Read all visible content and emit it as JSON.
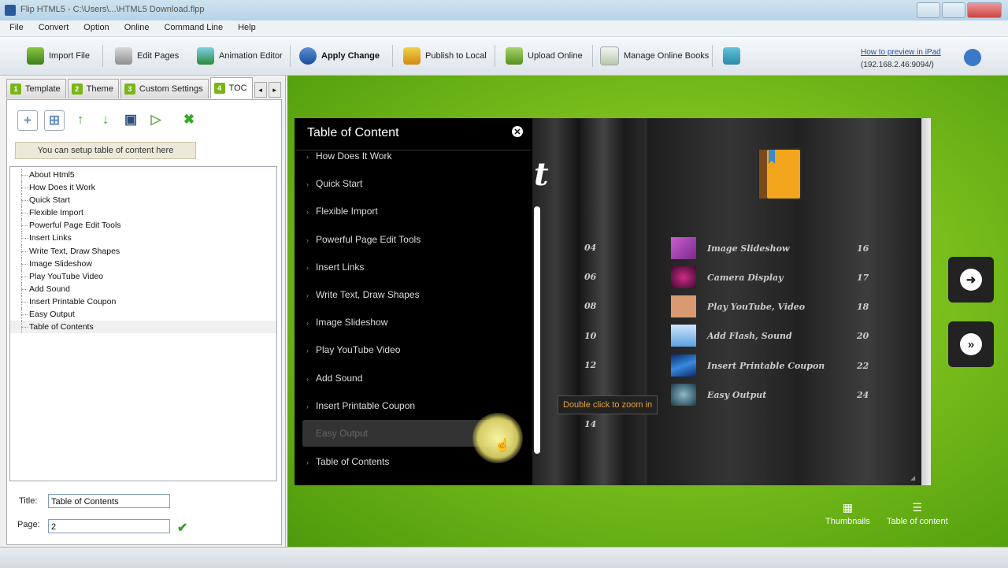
{
  "window": {
    "title": "Flip HTML5 - C:\\Users\\...\\HTML5 Download.flpp"
  },
  "menu": [
    "File",
    "Convert",
    "Option",
    "Online",
    "Command Line",
    "Help"
  ],
  "toolbar": {
    "import_file": "Import File",
    "edit_pages": "Edit Pages",
    "animation_editor": "Animation Editor",
    "apply_change": "Apply Change",
    "publish_local": "Publish to Local",
    "upload_online": "Upload Online",
    "manage_online_books": "Manage Online Books",
    "preview_link": "How to preview in iPad",
    "preview_ip": "(192.168.2.46:9094/)"
  },
  "tabs": [
    {
      "num": "1",
      "label": "Template"
    },
    {
      "num": "2",
      "label": "Theme"
    },
    {
      "num": "3",
      "label": "Custom Settings"
    },
    {
      "num": "4",
      "label": "TOC"
    }
  ],
  "toc_panel": {
    "hint": "You can setup table of content here",
    "tree": [
      "About Html5",
      "How Does it Work",
      "Quick Start",
      "Flexible Import",
      "Powerful Page Edit Tools",
      "Insert Links",
      "Write Text, Draw Shapes",
      "Image Slideshow",
      "Play YouTube Video",
      "Add Sound",
      "Insert Printable Coupon",
      "Easy Output",
      "Table of Contents"
    ],
    "title_label": "Title:",
    "title_value": "Table of Contents",
    "page_label": "Page:",
    "page_value": "2"
  },
  "viewer": {
    "toc_header": "Table of Content",
    "toc_items": [
      "How Does It Work",
      "Quick Start",
      "Flexible Import",
      "Powerful Page Edit Tools",
      "Insert Links",
      "Write Text, Draw Shapes",
      "Image Slideshow",
      "Play YouTube Video",
      "Add Sound",
      "Insert Printable Coupon",
      "Easy Output",
      "Table of Contents"
    ],
    "selected_item": "Easy Output",
    "book_title_fragment": "t",
    "left_page_numbers": [
      "04",
      "06",
      "08",
      "10",
      "12",
      "14"
    ],
    "right_entries": [
      {
        "label": "Image Slideshow",
        "page": "16",
        "color": "#b04bb8"
      },
      {
        "label": "Camera Display",
        "page": "17",
        "color": "#5a1043"
      },
      {
        "label": "Play YouTube, Video",
        "page": "18",
        "color": "#d99a72"
      },
      {
        "label": "Add Flash, Sound",
        "page": "20",
        "color": "#8fc6ef"
      },
      {
        "label": "Insert Printable Coupon",
        "page": "22",
        "color": "#1c5ab5"
      },
      {
        "label": "Easy Output",
        "page": "24",
        "color": "#3e6f88"
      }
    ],
    "zoom_tip": "Double click to zoom in",
    "thumbnails_label": "Thumbnails",
    "toc_button_label": "Table of content"
  },
  "colors": {
    "accent_green": "#7fc31e",
    "tab_green": "#7cb518",
    "link_blue": "#1a4fb4"
  }
}
